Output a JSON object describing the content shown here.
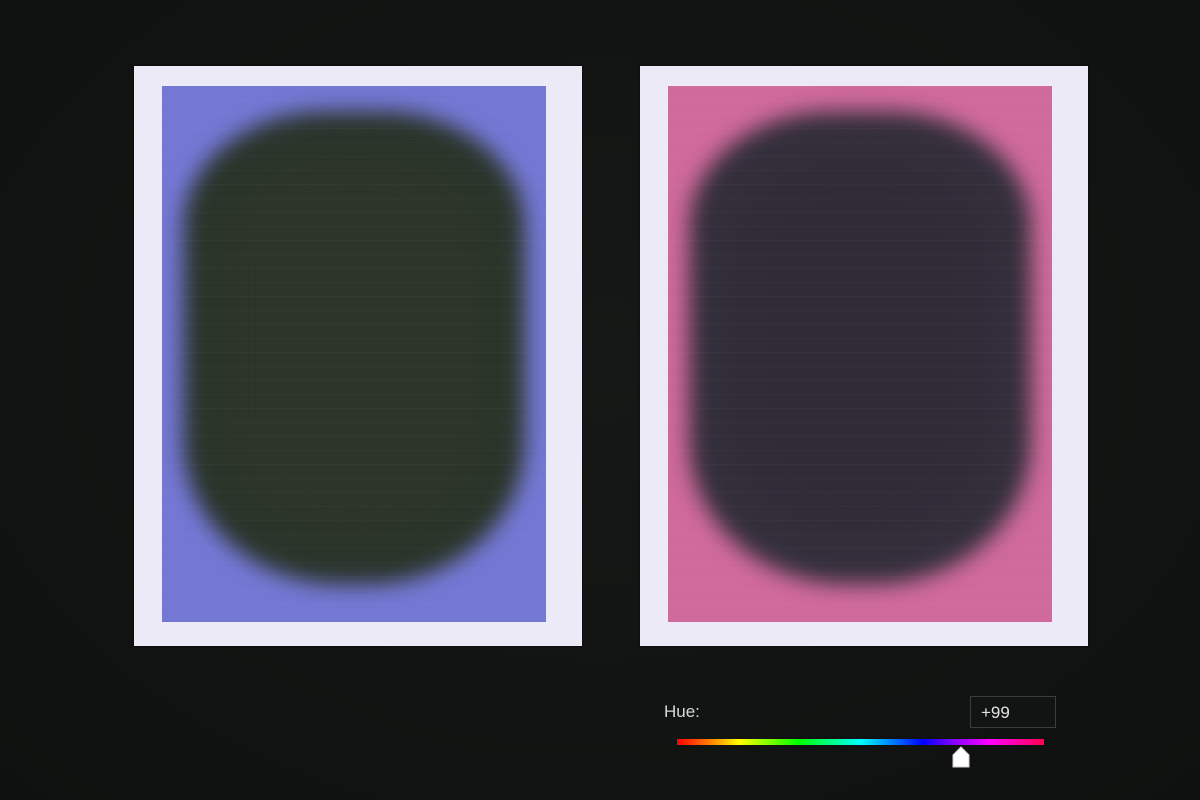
{
  "prints": [
    {
      "id": "original",
      "background_color": "#7478d4",
      "blob_color": "#2a352b",
      "blob_core_color": "#2e3526"
    },
    {
      "id": "hue-shifted",
      "background_color": "#d06a9c",
      "blob_color": "#35303c",
      "blob_core_color": "#2c2a36"
    }
  ],
  "hue_control": {
    "label": "Hue:",
    "value": "+99",
    "range": [
      -180,
      180
    ],
    "current": 99
  },
  "colors": {
    "background": "#121413",
    "print_border": "#eceaf6",
    "thumb": "#ffffff"
  },
  "icons": {
    "slider_thumb": "house-shaped-thumb-icon"
  }
}
